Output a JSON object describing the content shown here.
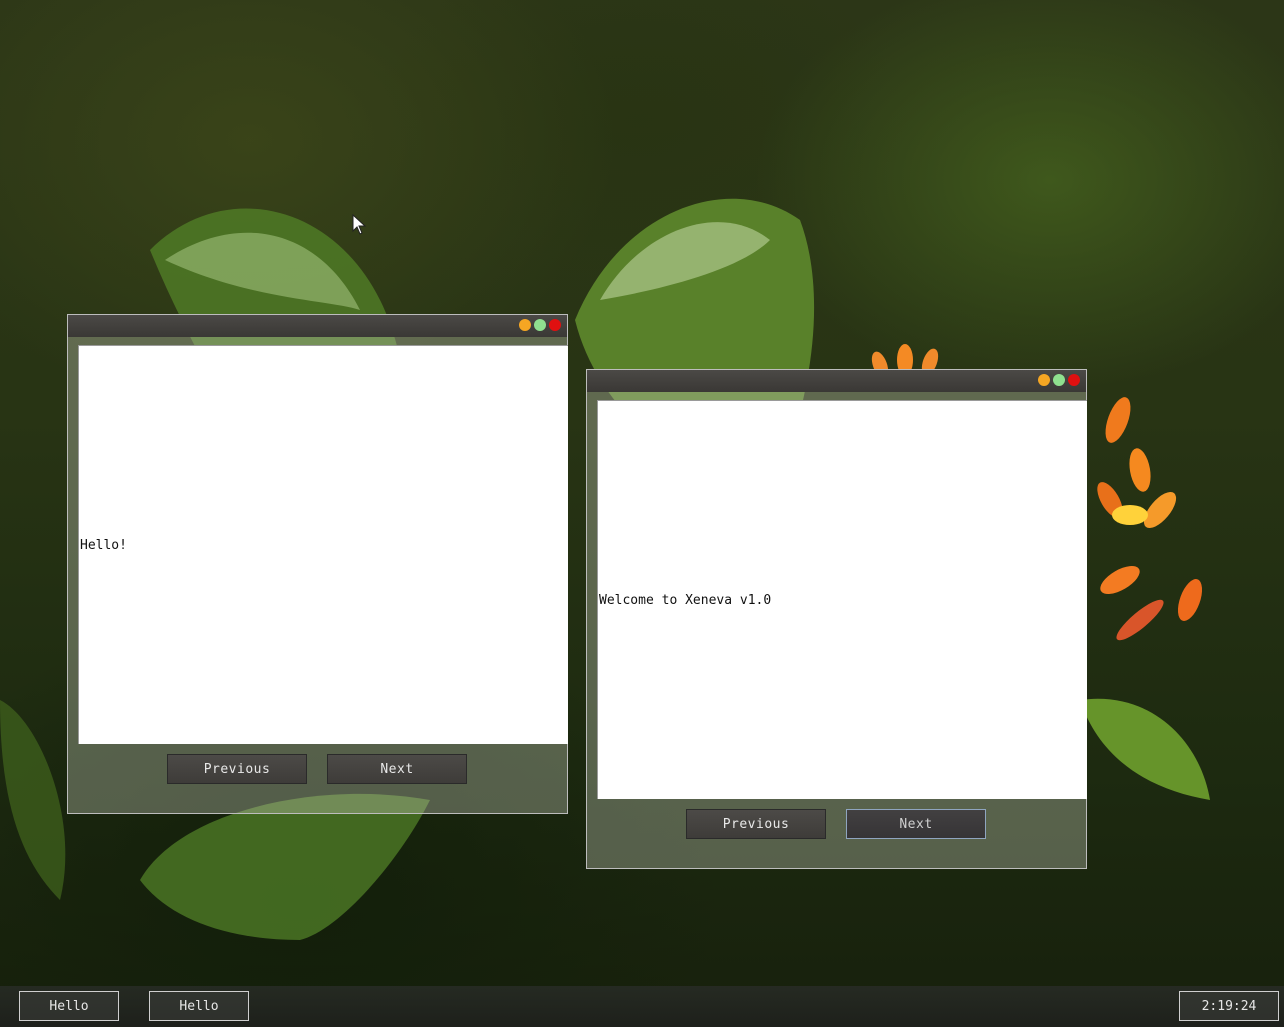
{
  "desktop": {
    "windows": [
      {
        "content_text": "Hello!",
        "buttons": {
          "previous": "Previous",
          "next": "Next"
        }
      },
      {
        "content_text": "Welcome to Xeneva v1.0",
        "buttons": {
          "previous": "Previous",
          "next": "Next"
        }
      }
    ],
    "titlebar_dots": {
      "minimize_color": "#f5a623",
      "maximize_color": "#8fe08f",
      "close_color": "#e01010"
    }
  },
  "taskbar": {
    "items": [
      "Hello",
      "Hello"
    ],
    "clock": "2:19:24"
  }
}
